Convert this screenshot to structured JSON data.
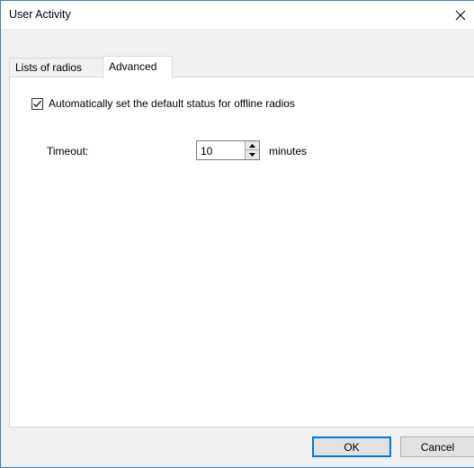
{
  "window": {
    "title": "User Activity",
    "close_icon": "close-icon"
  },
  "tabs": [
    {
      "label": "Lists of radios",
      "selected": false
    },
    {
      "label": "Advanced",
      "selected": true
    }
  ],
  "advanced": {
    "auto_status_label": "Automatically set the default status for offline radios",
    "auto_status_checked": true,
    "timeout_label": "Timeout:",
    "timeout_value": "10",
    "timeout_unit": "minutes"
  },
  "buttons": {
    "ok": "OK",
    "cancel": "Cancel"
  },
  "colors": {
    "accent": "#0078d7",
    "window_border": "#3c7fb1",
    "dialog_bg": "#f0f0f0"
  }
}
